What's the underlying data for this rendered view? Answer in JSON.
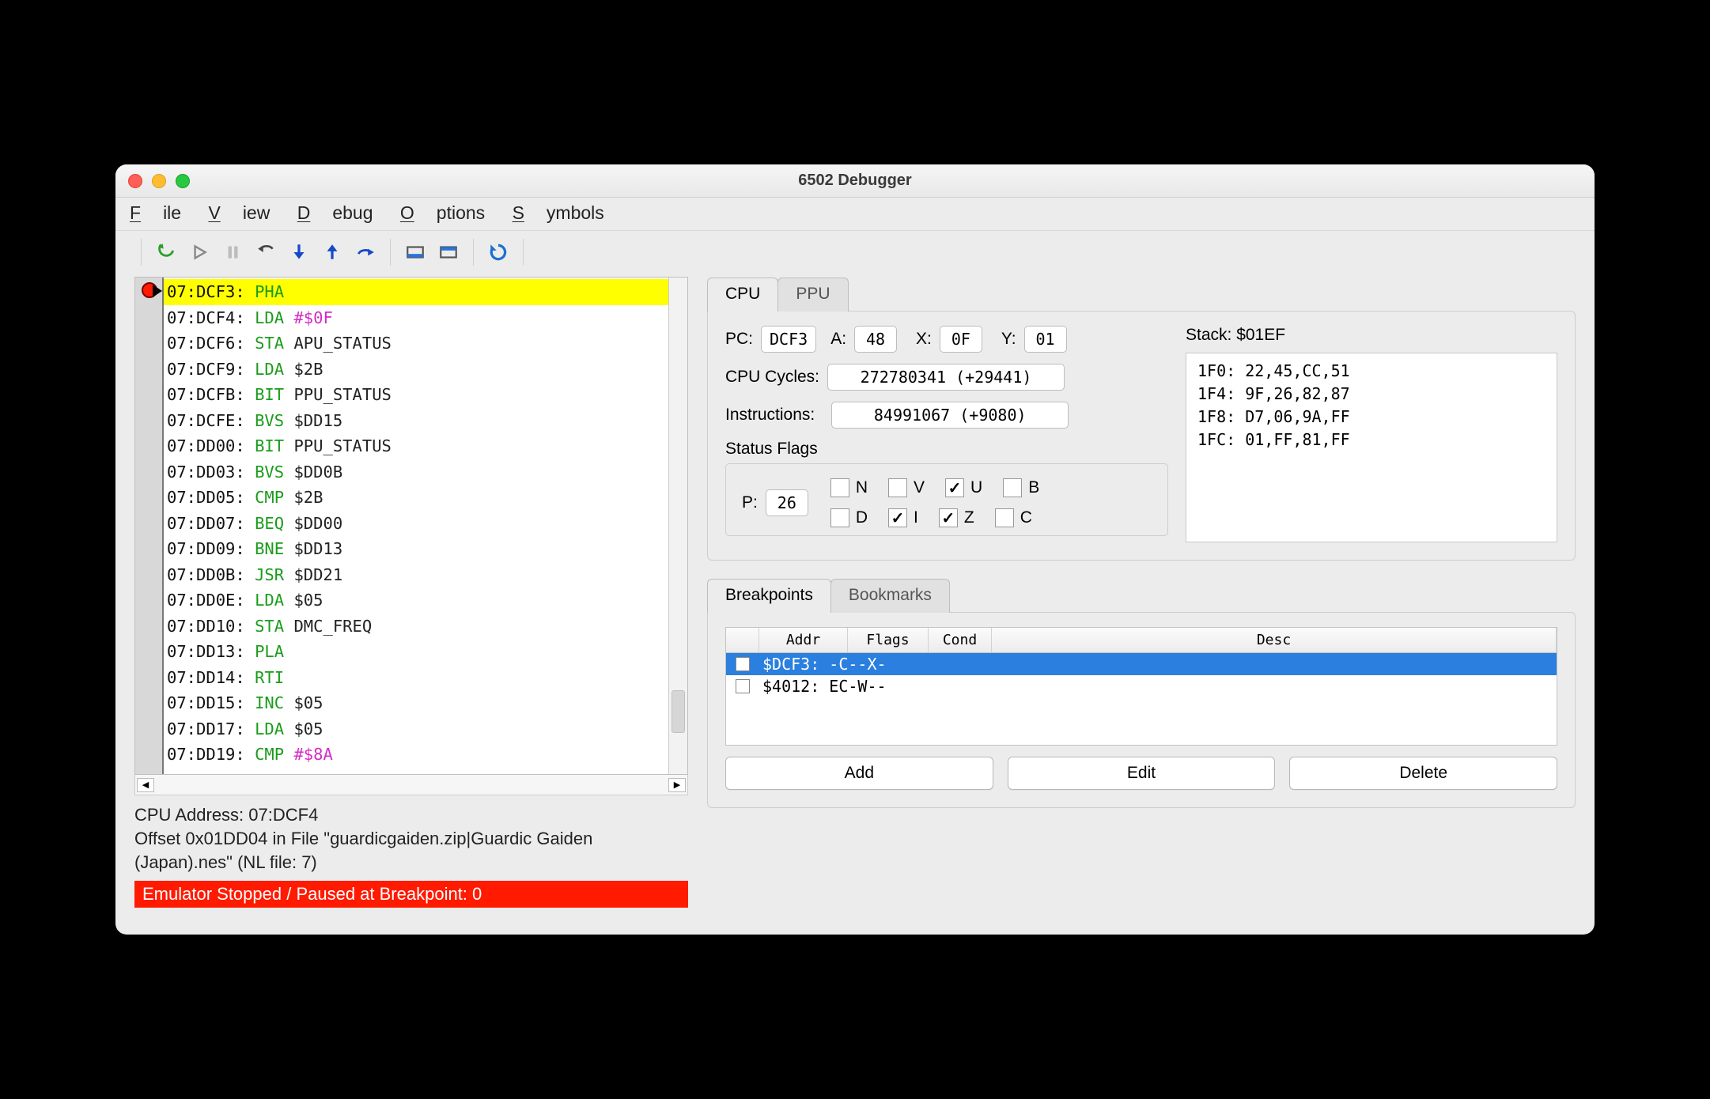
{
  "window": {
    "title": "6502 Debugger"
  },
  "menubar": [
    "File",
    "View",
    "Debug",
    "Options",
    "Symbols"
  ],
  "toolbar_icons": [
    "run-icon",
    "continue-icon",
    "pause-icon",
    "step-back-icon",
    "step-into-icon",
    "step-out-icon",
    "step-over-icon",
    "skip-to-icon",
    "skip-next-icon",
    "reload-icon"
  ],
  "disasm": [
    {
      "addr": "07:DCF3:",
      "mnem": "PHA",
      "op": "",
      "current": true,
      "bp": true
    },
    {
      "addr": "07:DCF4:",
      "mnem": "LDA",
      "op": "#$0F",
      "imm": true
    },
    {
      "addr": "07:DCF6:",
      "mnem": "STA",
      "op": "APU_STATUS"
    },
    {
      "addr": "07:DCF9:",
      "mnem": "LDA",
      "op": "$2B"
    },
    {
      "addr": "07:DCFB:",
      "mnem": "BIT",
      "op": "PPU_STATUS"
    },
    {
      "addr": "07:DCFE:",
      "mnem": "BVS",
      "op": "$DD15"
    },
    {
      "addr": "07:DD00:",
      "mnem": "BIT",
      "op": "PPU_STATUS"
    },
    {
      "addr": "07:DD03:",
      "mnem": "BVS",
      "op": "$DD0B"
    },
    {
      "addr": "07:DD05:",
      "mnem": "CMP",
      "op": "$2B"
    },
    {
      "addr": "07:DD07:",
      "mnem": "BEQ",
      "op": "$DD00"
    },
    {
      "addr": "07:DD09:",
      "mnem": "BNE",
      "op": "$DD13"
    },
    {
      "addr": "07:DD0B:",
      "mnem": "JSR",
      "op": "$DD21"
    },
    {
      "addr": "07:DD0E:",
      "mnem": "LDA",
      "op": "$05"
    },
    {
      "addr": "07:DD10:",
      "mnem": "STA",
      "op": "DMC_FREQ"
    },
    {
      "addr": "07:DD13:",
      "mnem": "PLA",
      "op": ""
    },
    {
      "addr": "07:DD14:",
      "mnem": "RTI",
      "op": ""
    },
    {
      "addr": "07:DD15:",
      "mnem": "INC",
      "op": "$05"
    },
    {
      "addr": "07:DD17:",
      "mnem": "LDA",
      "op": "$05"
    },
    {
      "addr": "07:DD19:",
      "mnem": "CMP",
      "op": "#$8A",
      "imm": true
    }
  ],
  "info": {
    "line1": "CPU Address: 07:DCF4",
    "line2": "Offset 0x01DD04 in File \"guardicgaiden.zip|Guardic Gaiden (Japan).nes\" (NL file: 7)"
  },
  "status": "Emulator Stopped / Paused at Breakpoint: 0",
  "tabs_top": [
    "CPU",
    "PPU"
  ],
  "cpu": {
    "pc_label": "PC:",
    "pc": "DCF3",
    "a_label": "A:",
    "a": "48",
    "x_label": "X:",
    "x": "0F",
    "y_label": "Y:",
    "y": "01",
    "cycles_label": "CPU Cycles:",
    "cycles": "272780341  (+29441)",
    "instr_label": "Instructions:",
    "instr": "84991067  (+9080)",
    "flags_title": "Status Flags",
    "p_label": "P:",
    "p": "26",
    "flags": [
      {
        "n": "N",
        "on": false
      },
      {
        "n": "V",
        "on": false
      },
      {
        "n": "U",
        "on": true
      },
      {
        "n": "B",
        "on": false
      },
      {
        "n": "D",
        "on": false
      },
      {
        "n": "I",
        "on": true
      },
      {
        "n": "Z",
        "on": true
      },
      {
        "n": "C",
        "on": false
      }
    ]
  },
  "stack": {
    "title": "Stack: $01EF",
    "lines": [
      "1F0: 22,45,CC,51",
      "1F4: 9F,26,82,87",
      "1F8: D7,06,9A,FF",
      "1FC: 01,FF,81,FF"
    ]
  },
  "tabs_bottom": [
    "Breakpoints",
    "Bookmarks"
  ],
  "bp": {
    "hdr": {
      "addr": "Addr",
      "flags": "Flags",
      "cond": "Cond",
      "desc": "Desc"
    },
    "rows": [
      {
        "checked": true,
        "text": "$DCF3: -C--X-",
        "sel": true
      },
      {
        "checked": false,
        "text": "$4012: EC-W--",
        "sel": false
      }
    ],
    "btn_add": "Add",
    "btn_edit": "Edit",
    "btn_del": "Delete"
  }
}
